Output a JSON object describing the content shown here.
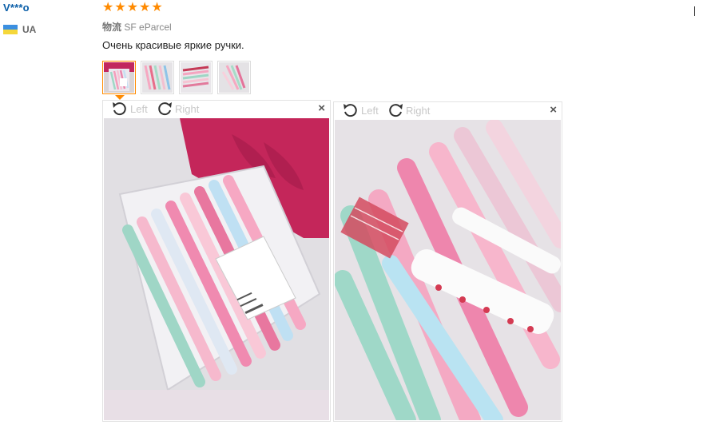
{
  "reviewer": {
    "name": "V***o",
    "country_code": "UA"
  },
  "rating": {
    "stars": 5,
    "max": 5,
    "color": "#ff8a00"
  },
  "logistics": {
    "carrier_cn": "物流",
    "carrier": "SF eParcel"
  },
  "review_text": "Очень красивые яркие ручки.",
  "thumbnails": [
    {
      "name": "thumb-1",
      "active": true
    },
    {
      "name": "thumb-2",
      "active": false
    },
    {
      "name": "thumb-3",
      "active": false
    },
    {
      "name": "thumb-4",
      "active": false
    }
  ],
  "viewer": {
    "rotate_left": "Left",
    "rotate_right": "Right",
    "close": "×"
  },
  "colors": {
    "username": "#0a5ea8",
    "accent": "#ff8a00"
  }
}
